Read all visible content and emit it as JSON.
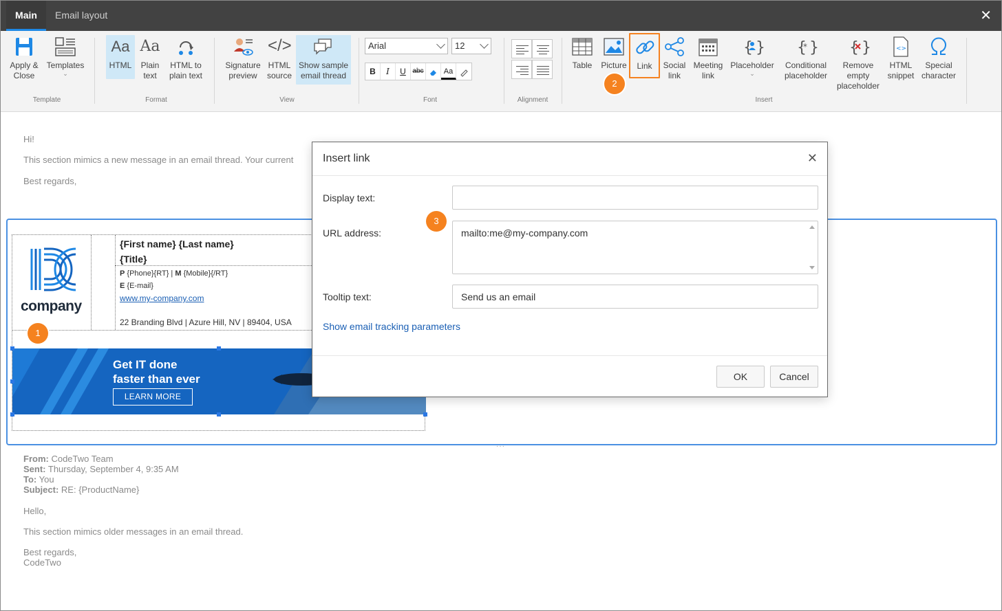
{
  "tabs": {
    "main": "Main",
    "email_layout": "Email layout"
  },
  "ribbon": {
    "template": {
      "group": "Template",
      "apply_close": [
        "Apply &",
        "Close"
      ],
      "templates": "Templates"
    },
    "format": {
      "group": "Format",
      "html": "HTML",
      "plain": [
        "Plain",
        "text"
      ],
      "html_to_plain": [
        "HTML to",
        "plain text"
      ]
    },
    "view": {
      "group": "View",
      "sig_preview": [
        "Signature",
        "preview"
      ],
      "html_source": [
        "HTML",
        "source"
      ],
      "sample_thread": [
        "Show sample",
        "email thread"
      ]
    },
    "font": {
      "group": "Font",
      "family": "Arial",
      "size": "12",
      "bold": "B",
      "italic": "I",
      "underline": "U",
      "strike": "abc",
      "color": "Aa"
    },
    "alignment": {
      "group": "Alignment"
    },
    "insert": {
      "group": "Insert",
      "table": "Table",
      "picture": "Picture",
      "link": "Link",
      "social": [
        "Social",
        "link"
      ],
      "meeting": [
        "Meeting",
        "link"
      ],
      "placeholder": "Placeholder",
      "conditional": [
        "Conditional",
        "placeholder"
      ],
      "remove_empty": [
        "Remove",
        "empty",
        "placeholder"
      ],
      "html_snippet": [
        "HTML",
        "snippet"
      ],
      "special": [
        "Special",
        "character"
      ]
    }
  },
  "badges": {
    "one": "1",
    "two": "2",
    "three": "3"
  },
  "content": {
    "greeting": "Hi!",
    "intro": "This section mimics a new message in an email thread. Your current",
    "regards": "Best regards,"
  },
  "signature": {
    "name": "{First name} {Last name}",
    "title": "{Title}",
    "phone_label": "P",
    "phone": " {Phone}{RT} | ",
    "mobile_label": "M",
    "mobile": " {Mobile}{/RT}",
    "email_label": "E",
    "email": " {E-mail}",
    "website": "www.my-company.com",
    "address": "22 Branding Blvd | Azure Hill, NV | 89404, USA",
    "logo_text": "company",
    "banner_line1": "Get IT done",
    "banner_line2": "faster than ever",
    "banner_cta": "LEARN MORE"
  },
  "thread": {
    "from_label": "From:",
    "from": " CodeTwo Team",
    "sent_label": "Sent:",
    "sent": " Thursday, September 4, 9:35 AM",
    "to_label": "To:",
    "to": " You",
    "subject_label": "Subject:",
    "subject": " RE: {ProductName}",
    "hello": "Hello,",
    "body": "This section mimics older messages in an email thread.",
    "regards": "Best regards,",
    "signoff": "CodeTwo"
  },
  "dialog": {
    "title": "Insert link",
    "display_text_label": "Display text:",
    "display_text_value": "",
    "url_label": "URL address:",
    "url_value": "mailto:me@my-company.com",
    "tooltip_label": "Tooltip text:",
    "tooltip_value": "Send us an email",
    "tracking_link": "Show email tracking parameters",
    "ok": "OK",
    "cancel": "Cancel"
  },
  "colors": {
    "accent": "#1e88e5",
    "highlight": "#f58220",
    "banner": "#1565c0",
    "selection": "#4a90e2"
  }
}
